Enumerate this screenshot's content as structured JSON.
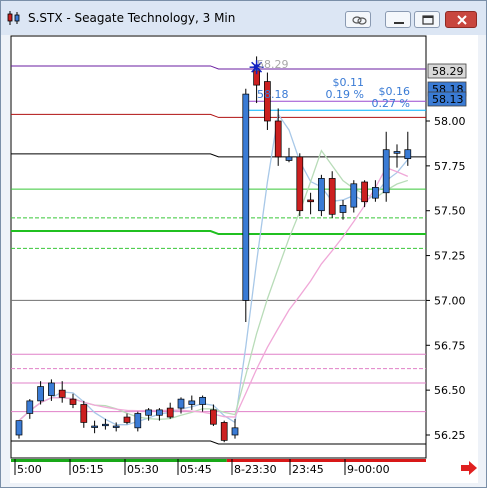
{
  "window": {
    "title": "S.STX - Seagate Technology, 3 Min",
    "buttons": [
      "link-icon",
      "minimize-icon",
      "restore-icon",
      "close-icon"
    ]
  },
  "colors": {
    "up_candle": "#3a7bd5",
    "down_candle": "#cc2020",
    "label_highlight": "#3a7bd5",
    "pct_text": "#3a7bd5"
  },
  "chart_data": {
    "type": "candlestick",
    "symbol": "S.STX",
    "interval": "3 Min",
    "y_axis": {
      "ticks": [
        "58.00",
        "57.75",
        "57.50",
        "57.25",
        "57.00",
        "56.75",
        "56.50",
        "56.25"
      ],
      "range": [
        56.17,
        58.4
      ]
    },
    "x_axis": {
      "ticks": [
        "5:00",
        "05:15",
        "05:30",
        "05:45",
        "8-23:30",
        "23:45",
        "9-00:00"
      ]
    },
    "price_badges": [
      {
        "value": "58.29",
        "style": "gray"
      },
      {
        "value": "58.18",
        "style": "blue",
        "partial": true
      },
      {
        "value": "58.13",
        "style": "blue"
      }
    ],
    "annotations": {
      "high_label": "58.29",
      "level_label": "58.18",
      "change_1": "$0.11",
      "pct_1": "0.19 %",
      "change_2": "$0.16",
      "pct_2": "0.27 %"
    },
    "candles": [
      {
        "o": 56.25,
        "h": 56.33,
        "l": 56.23,
        "c": 56.33
      },
      {
        "o": 56.37,
        "h": 56.45,
        "l": 56.34,
        "c": 56.44
      },
      {
        "o": 56.44,
        "h": 56.55,
        "l": 56.42,
        "c": 56.52
      },
      {
        "o": 56.47,
        "h": 56.56,
        "l": 56.44,
        "c": 56.54
      },
      {
        "o": 56.5,
        "h": 56.55,
        "l": 56.43,
        "c": 56.46
      },
      {
        "o": 56.45,
        "h": 56.48,
        "l": 56.4,
        "c": 56.42
      },
      {
        "o": 56.42,
        "h": 56.44,
        "l": 56.29,
        "c": 56.32
      },
      {
        "o": 56.3,
        "h": 56.33,
        "l": 56.26,
        "c": 56.3
      },
      {
        "o": 56.31,
        "h": 56.34,
        "l": 56.28,
        "c": 56.31
      },
      {
        "o": 56.3,
        "h": 56.32,
        "l": 56.27,
        "c": 56.3
      },
      {
        "o": 56.35,
        "h": 56.37,
        "l": 56.31,
        "c": 56.32
      },
      {
        "o": 56.29,
        "h": 56.38,
        "l": 56.27,
        "c": 56.37
      },
      {
        "o": 56.36,
        "h": 56.4,
        "l": 56.33,
        "c": 56.39
      },
      {
        "o": 56.36,
        "h": 56.4,
        "l": 56.33,
        "c": 56.39
      },
      {
        "o": 56.4,
        "h": 56.43,
        "l": 56.34,
        "c": 56.35
      },
      {
        "o": 56.4,
        "h": 56.46,
        "l": 56.37,
        "c": 56.45
      },
      {
        "o": 56.42,
        "h": 56.47,
        "l": 56.39,
        "c": 56.44
      },
      {
        "o": 56.42,
        "h": 56.47,
        "l": 56.38,
        "c": 56.46
      },
      {
        "o": 56.39,
        "h": 56.42,
        "l": 56.3,
        "c": 56.31
      },
      {
        "o": 56.32,
        "h": 56.33,
        "l": 56.21,
        "c": 56.22
      },
      {
        "o": 56.25,
        "h": 56.34,
        "l": 56.23,
        "c": 56.29
      },
      {
        "o": 57.0,
        "h": 58.18,
        "l": 56.88,
        "c": 58.15
      },
      {
        "o": 58.28,
        "h": 58.36,
        "l": 58.1,
        "c": 58.2
      },
      {
        "o": 58.22,
        "h": 58.27,
        "l": 57.95,
        "c": 58.0
      },
      {
        "o": 58.0,
        "h": 58.07,
        "l": 57.75,
        "c": 57.8
      },
      {
        "o": 57.78,
        "h": 57.85,
        "l": 57.77,
        "c": 57.8
      },
      {
        "o": 57.8,
        "h": 57.82,
        "l": 57.47,
        "c": 57.5
      },
      {
        "o": 57.56,
        "h": 57.6,
        "l": 57.48,
        "c": 57.55
      },
      {
        "o": 57.5,
        "h": 57.7,
        "l": 57.47,
        "c": 57.68
      },
      {
        "o": 57.68,
        "h": 57.72,
        "l": 57.46,
        "c": 57.48
      },
      {
        "o": 57.49,
        "h": 57.56,
        "l": 57.45,
        "c": 57.53
      },
      {
        "o": 57.52,
        "h": 57.67,
        "l": 57.49,
        "c": 57.65
      },
      {
        "o": 57.66,
        "h": 57.67,
        "l": 57.52,
        "c": 57.55
      },
      {
        "o": 57.57,
        "h": 57.67,
        "l": 57.55,
        "c": 57.63
      },
      {
        "o": 57.6,
        "h": 57.94,
        "l": 57.55,
        "c": 57.84
      },
      {
        "o": 57.82,
        "h": 57.87,
        "l": 57.74,
        "c": 57.83
      },
      {
        "o": 57.79,
        "h": 57.94,
        "l": 57.75,
        "c": 57.84
      }
    ],
    "levels": [
      {
        "price": 58.29,
        "color": "#6a1ea0",
        "x0": 0,
        "x1": 1,
        "step": 0.5
      },
      {
        "price": 58.11,
        "color": "#9a4ad0",
        "x0": 0.56,
        "x1": 1,
        "step": 0
      },
      {
        "price": 58.06,
        "color": "#00b4ff",
        "x0": 0.56,
        "x1": 1,
        "step": 0
      },
      {
        "price": 58.02,
        "color": "#b01010",
        "x0": 0,
        "x1": 1,
        "step": 0.5
      },
      {
        "price": 57.8,
        "color": "#000000",
        "x0": 0,
        "x1": 1,
        "step": 0.5
      },
      {
        "price": 57.62,
        "color": "#38c838",
        "x0": 0,
        "x1": 1,
        "step": 0
      },
      {
        "price": 57.46,
        "color": "#38c838",
        "x0": 0,
        "x1": 1,
        "step": 0,
        "dash": true
      },
      {
        "price": 57.37,
        "color": "#20c020",
        "x0": 0,
        "x1": 1,
        "step": 0.5,
        "width": 2
      },
      {
        "price": 57.29,
        "color": "#38c838",
        "x0": 0,
        "x1": 1,
        "step": 0,
        "dash": true
      },
      {
        "price": 57.0,
        "color": "#707070",
        "x0": 0,
        "x1": 1,
        "step": 0
      },
      {
        "price": 56.7,
        "color": "#e080c8",
        "x0": 0,
        "x1": 1,
        "step": 0
      },
      {
        "price": 56.62,
        "color": "#e080c8",
        "x0": 0,
        "x1": 1,
        "step": 0,
        "dash": true
      },
      {
        "price": 56.54,
        "color": "#e080c8",
        "x0": 0,
        "x1": 1,
        "step": 0
      },
      {
        "price": 56.38,
        "color": "#e080c8",
        "x0": 0,
        "x1": 1,
        "step": 0
      },
      {
        "price": 56.2,
        "color": "#000000",
        "x0": 0,
        "x1": 1,
        "step": 0.5
      }
    ],
    "time_bar": [
      {
        "from": 0,
        "to": 0.52,
        "color": "#18a818"
      },
      {
        "from": 0.52,
        "to": 1,
        "color": "#d81818"
      }
    ]
  }
}
